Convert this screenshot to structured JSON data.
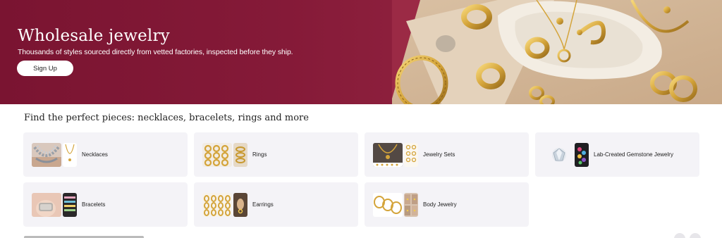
{
  "hero": {
    "title": "Wholesale jewelry",
    "subtitle": "Thousands of styles sourced directly from vetted factories, inspected before they ship.",
    "cta_label": "Sign Up",
    "background_color": "#851a38"
  },
  "section": {
    "title": "Find the perfect pieces: necklaces, bracelets, rings and more"
  },
  "categories": [
    {
      "label": "Necklaces"
    },
    {
      "label": "Rings"
    },
    {
      "label": "Jewelry Sets"
    },
    {
      "label": "Lab-Created Gemstone Jewelry"
    },
    {
      "label": "Bracelets"
    },
    {
      "label": "Earrings"
    },
    {
      "label": "Body Jewelry"
    }
  ],
  "colors": {
    "card_background": "#f4f3f7",
    "gold": "#d4a43a"
  }
}
